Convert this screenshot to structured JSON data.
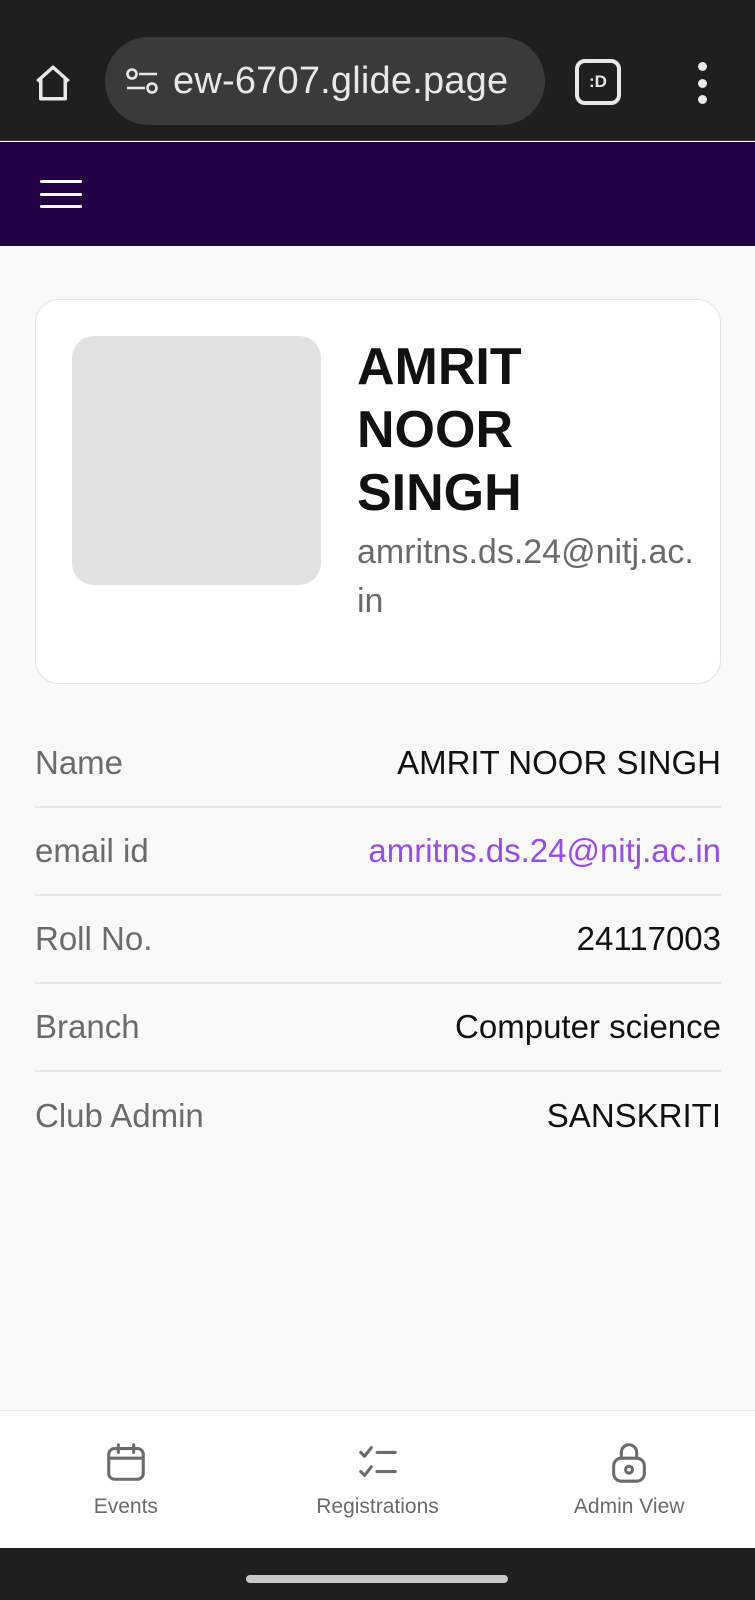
{
  "browser": {
    "url": "ew-6707.glide.page",
    "tabs_label": ":D"
  },
  "profile": {
    "name": "AMRIT NOOR SINGH",
    "email": "amritns.ds.24@nitj.ac.in"
  },
  "details": [
    {
      "label": "Name",
      "value": "AMRIT NOOR SINGH"
    },
    {
      "label": "email id",
      "value": "amritns.ds.24@nitj.ac.in"
    },
    {
      "label": "Roll No.",
      "value": "24117003"
    },
    {
      "label": "Branch",
      "value": "Computer science"
    },
    {
      "label": "Club Admin",
      "value": "SANSKRITI"
    }
  ],
  "bottom_nav": [
    {
      "label": "Events",
      "icon": "calendar-icon"
    },
    {
      "label": "Registrations",
      "icon": "checklist-icon"
    },
    {
      "label": "Admin View",
      "icon": "lock-icon"
    }
  ],
  "colors": {
    "header_bg": "#220044",
    "link": "#9a4bf0"
  }
}
